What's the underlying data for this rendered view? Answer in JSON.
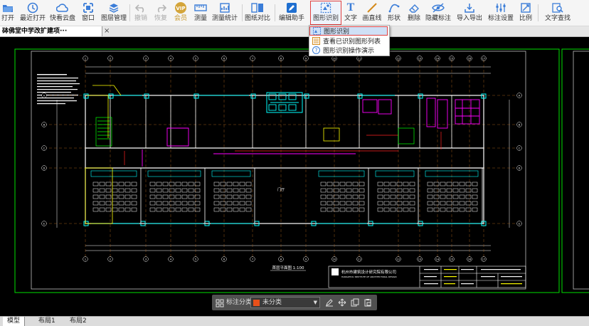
{
  "toolbar": {
    "buttons": [
      {
        "id": "open",
        "label": "打开",
        "icon": "folder-open-icon"
      },
      {
        "id": "recent",
        "label": "最近打开",
        "icon": "clock-icon"
      },
      {
        "id": "cloud",
        "label": "快看云盘",
        "icon": "cloud-icon"
      },
      {
        "id": "window",
        "label": "窗口",
        "icon": "window-icon"
      },
      {
        "id": "layers",
        "label": "图层管理",
        "icon": "layers-icon"
      },
      {
        "id": "undo",
        "label": "撤销",
        "icon": "undo-icon"
      },
      {
        "id": "redo",
        "label": "恢复",
        "icon": "redo-icon"
      },
      {
        "id": "vip",
        "label": "会员",
        "icon": "vip-icon",
        "badge": "VIP"
      },
      {
        "id": "measure",
        "label": "测量",
        "icon": "ruler-icon"
      },
      {
        "id": "measure_stats",
        "label": "测量统计",
        "icon": "measure-stats-icon"
      },
      {
        "id": "compare",
        "label": "图纸对比",
        "icon": "compare-icon"
      },
      {
        "id": "edit_helper",
        "label": "编辑助手",
        "icon": "edit-helper-icon"
      },
      {
        "id": "shape_recog",
        "label": "图形识别",
        "icon": "shape-recognition-icon"
      },
      {
        "id": "text",
        "label": "文字",
        "icon": "text-icon",
        "glyph": "T"
      },
      {
        "id": "line",
        "label": "画直线",
        "icon": "line-icon"
      },
      {
        "id": "shape",
        "label": "形状",
        "icon": "shape-icon"
      },
      {
        "id": "erase",
        "label": "删除",
        "icon": "eraser-icon"
      },
      {
        "id": "hide_mark",
        "label": "隐藏标注",
        "icon": "eye-hide-icon"
      },
      {
        "id": "import_mark",
        "label": "导入导出",
        "icon": "import-export-icon"
      },
      {
        "id": "mark_settings",
        "label": "标注设置",
        "icon": "mark-settings-icon"
      },
      {
        "id": "scale",
        "label": "比例",
        "icon": "scale-icon"
      },
      {
        "id": "text_search",
        "label": "文字查找",
        "icon": "text-search-icon"
      }
    ]
  },
  "document_tab": {
    "title": "砵佛堂中学改扩建项···",
    "close": "×"
  },
  "dropdown_menu": {
    "items": [
      {
        "label": "图形识别",
        "icon": "shape-recognition-icon"
      },
      {
        "label": "查看已识别图形列表",
        "icon": "list-icon"
      },
      {
        "label": "图形识别操作演示",
        "icon": "help-icon",
        "glyph": "?"
      }
    ]
  },
  "drawing": {
    "company": "杭州市建筑设计研究院有限公司",
    "company_en": "HANGZHOU INSTITUTE OF ARCHITECTURAL DESIGN",
    "plan_title": "首层平面图 1:100",
    "column_labels": [
      "1",
      "2",
      "3",
      "4",
      "5",
      "6",
      "7",
      "8",
      "9",
      "10",
      "11",
      "12",
      "13",
      "14",
      "15",
      "16",
      "17"
    ],
    "row_labels": [
      "A",
      "B",
      "C",
      "D",
      "E"
    ],
    "room_label": "门厅"
  },
  "float_toolbar": {
    "category_label": "标注分类",
    "selected_category": "未分类",
    "category_color": "#e8501a"
  },
  "bottom_tabs": [
    "模型",
    "布局1",
    "布局2"
  ],
  "colors": {
    "accent": "#1f6fd0",
    "highlight_border": "#e04040",
    "canvas": "#000000",
    "cyan": "#00ffff",
    "magenta": "#ff00ff"
  }
}
